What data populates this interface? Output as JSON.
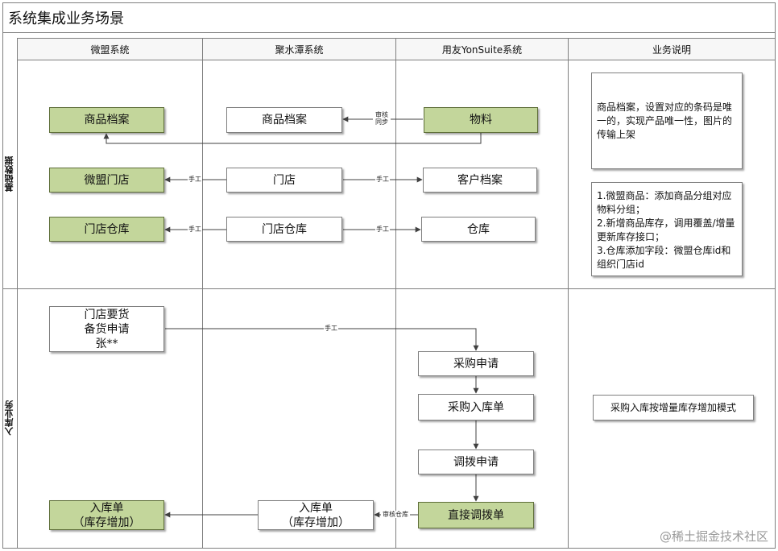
{
  "title": "系统集成业务场景",
  "columns": [
    "微盟系统",
    "聚水潭系统",
    "用友YonSuite系统",
    "业务说明"
  ],
  "lanes": [
    "基础数据",
    "入库业务"
  ],
  "boxes": {
    "wm_goods": "商品档案",
    "jst_goods": "商品档案",
    "ys_material": "物料",
    "wm_store": "微盟门店",
    "jst_store": "门店",
    "ys_customer": "客户档案",
    "wm_warehouse": "门店仓库",
    "jst_warehouse": "门店仓库",
    "ys_warehouse": "仓库",
    "wm_request": "门店要货\n备货申请\n张**",
    "ys_purchase_request": "采购申请",
    "ys_purchase_inbound": "采购入库单",
    "ys_transfer_request": "调拨申请",
    "ys_direct_transfer": "直接调拨单",
    "wm_inbound": "入库单\n（库存增加）",
    "jst_inbound": "入库单\n（库存增加）"
  },
  "notes": {
    "goods_note": "商品档案，设置对应的条码是唯一的，实现产品唯一性，图片的传输上架",
    "base_note": "1.微盟商品：添加商品分组对应物料分组；\n2.新增商品库存，调用覆盖/增量更新库存接口；\n3.仓库添加字段：微盟仓库id和组织门店id",
    "inbound_note": "采购入库按增量库存增加模式"
  },
  "arrow_labels": {
    "review_sync": "审核\n同步",
    "manual_store_wm": "手工",
    "manual_store_ys": "手工",
    "manual_wh_wm": "手工",
    "manual_wh_ys": "手工",
    "manual_request": "手工",
    "audit_warehouse": "审核仓库"
  },
  "colors": {
    "green_fill": "#c3d69b",
    "green_border": "#5f6f3a",
    "line": "#404040",
    "border": "#7f7f7f"
  },
  "watermark": "@稀土掘金技术社区"
}
